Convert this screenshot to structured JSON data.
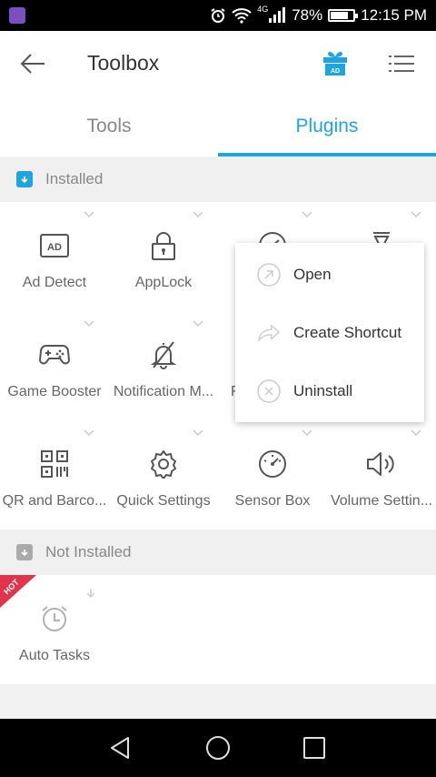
{
  "status_bar": {
    "network": "4G",
    "battery": "78%",
    "battery_level": 0.78,
    "time": "12:15 PM",
    "icons": [
      "alarm-icon",
      "wifi-icon",
      "signal-icon",
      "battery-icon"
    ]
  },
  "app_bar": {
    "title": "Toolbox",
    "back_icon": "back-arrow-icon",
    "gift_icon": "gift-ad-icon",
    "gift_badge": "AD",
    "menu_icon": "list-menu-icon"
  },
  "tabs": [
    {
      "label": "Tools",
      "active": false
    },
    {
      "label": "Plugins",
      "active": true
    }
  ],
  "colors": {
    "accent": "#1ea4e0",
    "hot": "#e0344a"
  },
  "installed": {
    "header": "Installed",
    "items": [
      {
        "label": "Ad Detect",
        "icon": "ad-detect-icon",
        "badge": "AD"
      },
      {
        "label": "AppLock",
        "icon": "lock-icon"
      },
      {
        "label": "",
        "icon": "speedometer-icon"
      },
      {
        "label": "",
        "icon": "flashlight-icon"
      },
      {
        "label": "Game Booster",
        "icon": "gamepad-icon"
      },
      {
        "label": "Notification M...",
        "icon": "bell-off-icon"
      },
      {
        "label": "F",
        "icon": ""
      },
      {
        "label": "",
        "icon": ""
      },
      {
        "label": "QR and Barco...",
        "icon": "qr-code-icon"
      },
      {
        "label": "Quick Settings",
        "icon": "gear-icon"
      },
      {
        "label": "Sensor Box",
        "icon": "gauge-icon"
      },
      {
        "label": "Volume Settin...",
        "icon": "speaker-icon"
      }
    ]
  },
  "not_installed": {
    "header": "Not Installed",
    "items": [
      {
        "label": "Auto Tasks",
        "icon": "alarm-clock-icon",
        "hot": "HOT",
        "action_icon": "download-arrow-icon"
      }
    ]
  },
  "popup_menu": {
    "items": [
      {
        "label": "Open",
        "icon": "open-icon"
      },
      {
        "label": "Create Shortcut",
        "icon": "share-arrow-icon"
      },
      {
        "label": "Uninstall",
        "icon": "close-circle-icon"
      }
    ]
  },
  "nav_bar": {
    "icons": [
      "back-triangle-icon",
      "home-circle-icon",
      "recents-square-icon"
    ]
  }
}
